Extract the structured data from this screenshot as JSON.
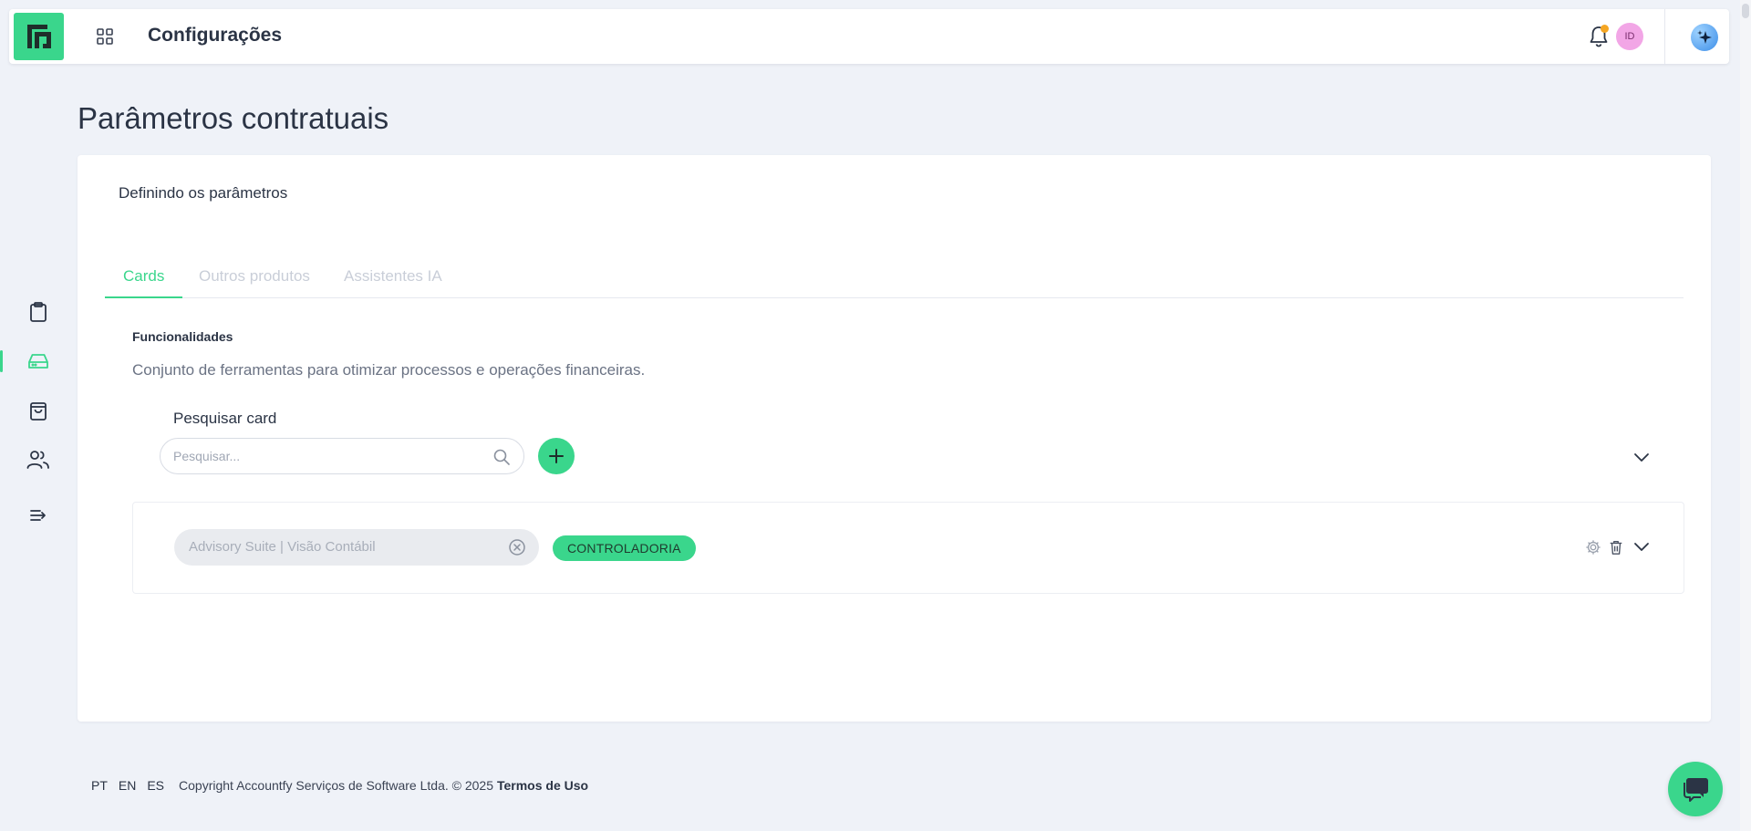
{
  "header": {
    "title": "Configurações",
    "avatar_initials": "ID",
    "colors": {
      "brand": "#3ad68c",
      "notification_dot": "#f5a623",
      "avatar_bg": "#f2a6e6"
    }
  },
  "page": {
    "title": "Parâmetros contratuais",
    "subtitle": "Definindo os parâmetros"
  },
  "tabs": [
    {
      "label": "Cards",
      "active": true
    },
    {
      "label": "Outros produtos",
      "active": false
    },
    {
      "label": "Assistentes IA",
      "active": false
    }
  ],
  "section": {
    "label": "Funcionalidades",
    "description": "Conjunto de ferramentas para otimizar processos e operações financeiras."
  },
  "search": {
    "label": "Pesquisar card",
    "placeholder": "Pesquisar..."
  },
  "items": [
    {
      "name": "Advisory Suite | Visão Contábil",
      "tag": "CONTROLADORIA"
    }
  ],
  "footer": {
    "languages": [
      "PT",
      "EN",
      "ES"
    ],
    "copyright": "Copyright Accountfy Serviços de Software Ltda. © 2025",
    "terms": "Termos de Uso"
  },
  "icons": {
    "sidebar": [
      "clipboard-icon",
      "inbox-icon",
      "shopping-bag-icon",
      "users-icon",
      "expand-menu-icon"
    ]
  }
}
